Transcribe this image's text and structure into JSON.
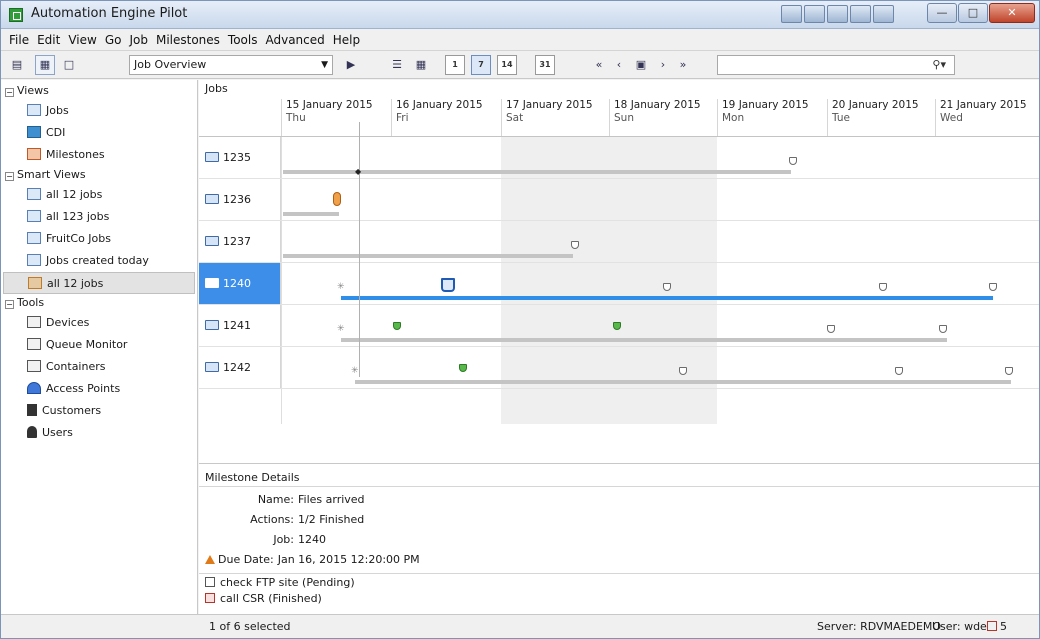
{
  "window": {
    "title": "Automation Engine Pilot"
  },
  "menu": [
    "File",
    "Edit",
    "View",
    "Go",
    "Job",
    "Milestones",
    "Tools",
    "Advanced",
    "Help"
  ],
  "toolbar": {
    "view_selected": "Job Overview",
    "calendar_buttons": [
      "1",
      "7",
      "14",
      "31"
    ],
    "search_value": "",
    "search_icon": "search-icon"
  },
  "sidebar": {
    "groups": [
      {
        "label": "Views",
        "items": [
          "Jobs",
          "CDI",
          "Milestones"
        ]
      },
      {
        "label": "Smart Views",
        "items": [
          "all 12 jobs",
          "all 123 jobs",
          "FruitCo Jobs",
          "Jobs created today",
          "all 12 jobs"
        ]
      },
      {
        "label": "Tools",
        "items": [
          "Devices",
          "Queue Monitor",
          "Containers",
          "Access Points",
          "Customers",
          "Users"
        ]
      }
    ]
  },
  "jobs": {
    "header": "Jobs",
    "dates": [
      {
        "date": "15 January 2015",
        "day": "Thu"
      },
      {
        "date": "16 January 2015",
        "day": "Fri"
      },
      {
        "date": "17 January 2015",
        "day": "Sat"
      },
      {
        "date": "18 January 2015",
        "day": "Sun"
      },
      {
        "date": "19 January 2015",
        "day": "Mon"
      },
      {
        "date": "20 January 2015",
        "day": "Tue"
      },
      {
        "date": "21 January 2015",
        "day": "Wed"
      }
    ],
    "rows": [
      {
        "job": "1235"
      },
      {
        "job": "1236"
      },
      {
        "job": "1237"
      },
      {
        "job": "1240"
      },
      {
        "job": "1241"
      },
      {
        "job": "1242"
      }
    ],
    "selected_job": "1240"
  },
  "details": {
    "title": "Milestone Details",
    "name_label": "Name:",
    "name": "Files arrived",
    "actions_label": "Actions:",
    "actions": "1/2 Finished",
    "job_label": "Job:",
    "job": "1240",
    "due_label": "Due Date:",
    "due": "Jan 16, 2015 12:20:00 PM",
    "action_items": [
      "check FTP site (Pending)",
      "call CSR (Finished)"
    ]
  },
  "status": {
    "selection": "1 of 6 selected",
    "server": "Server: RDVMAEDEMO",
    "user": "User: wde",
    "count": "5"
  },
  "colors": {
    "selection": "#3d8ee8",
    "active_bar": "#2f8fe8",
    "weekend": "#efefef"
  }
}
